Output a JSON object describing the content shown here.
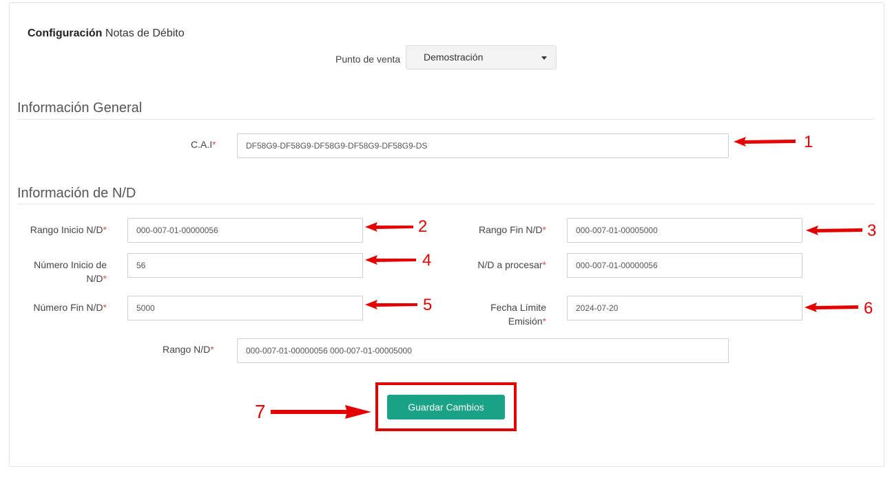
{
  "page": {
    "title_bold": "Configuración",
    "title_rest": "Notas de Débito"
  },
  "pos": {
    "label": "Punto de venta",
    "selected": "Demostración"
  },
  "sections": {
    "general": "Información General",
    "nd": "Información de N/D"
  },
  "required_mark": "*",
  "fields": {
    "cai": {
      "label": "C.A.I",
      "value": "DF58G9-DF58G9-DF58G9-DF58G9-DF58G9-DS"
    },
    "rango_inicio": {
      "label": "Rango Inicio N/D",
      "value": "000-007-01-00000056"
    },
    "rango_fin": {
      "label": "Rango Fin N/D",
      "value": "000-007-01-00005000"
    },
    "numero_inicio": {
      "label_line1": "Número Inicio de",
      "label_line2": "N/D",
      "value": "56"
    },
    "nd_procesar": {
      "label": "N/D a procesar",
      "value": "000-007-01-00000056"
    },
    "numero_fin": {
      "label": "Número Fin N/D",
      "value": "5000"
    },
    "fecha_limite": {
      "label_line1": "Fecha Límite",
      "label_line2": "Emisión",
      "value": "2024-07-20"
    },
    "rango_nd": {
      "label": "Rango N/D",
      "value": "000-007-01-00000056 000-007-01-00005000"
    }
  },
  "save_button": "Guardar Cambios",
  "annotations": {
    "color": "#e50000",
    "numbers": [
      "1",
      "2",
      "3",
      "4",
      "5",
      "6",
      "7"
    ]
  }
}
